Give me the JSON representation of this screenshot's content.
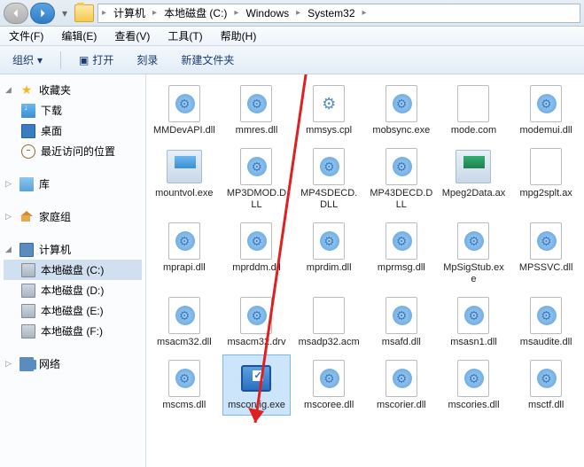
{
  "breadcrumb": {
    "items": [
      "计算机",
      "本地磁盘 (C:)",
      "Windows",
      "System32"
    ]
  },
  "menu": {
    "file": "文件(F)",
    "edit": "编辑(E)",
    "view": "查看(V)",
    "tools": "工具(T)",
    "help": "帮助(H)"
  },
  "toolbar": {
    "organize": "组织",
    "open": "打开",
    "burn": "刻录",
    "newfolder": "新建文件夹"
  },
  "sidebar": {
    "favorites": "收藏夹",
    "downloads": "下载",
    "desktop": "桌面",
    "recent": "最近访问的位置",
    "library": "库",
    "homegroup": "家庭组",
    "computer": "计算机",
    "drive_c": "本地磁盘 (C:)",
    "drive_d": "本地磁盘 (D:)",
    "drive_e": "本地磁盘 (E:)",
    "drive_f": "本地磁盘 (F:)",
    "network": "网络"
  },
  "files": [
    {
      "name": "MMDevAPI.dll",
      "type": "dll"
    },
    {
      "name": "mmres.dll",
      "type": "dll"
    },
    {
      "name": "mmsys.cpl",
      "type": "cpl"
    },
    {
      "name": "mobsync.exe",
      "type": "exe"
    },
    {
      "name": "mode.com",
      "type": "gen"
    },
    {
      "name": "modemui.dll",
      "type": "dll"
    },
    {
      "name": "mountvol.exe",
      "type": "mount"
    },
    {
      "name": "MP3DMOD.DLL",
      "type": "dll"
    },
    {
      "name": "MP4SDECD.DLL",
      "type": "dll"
    },
    {
      "name": "MP43DECD.DLL",
      "type": "dll"
    },
    {
      "name": "Mpeg2Data.ax",
      "type": "mpeg"
    },
    {
      "name": "mpg2splt.ax",
      "type": "gen"
    },
    {
      "name": "mprapi.dll",
      "type": "dll"
    },
    {
      "name": "mprddm.dll",
      "type": "dll"
    },
    {
      "name": "mprdim.dll",
      "type": "dll"
    },
    {
      "name": "mprmsg.dll",
      "type": "dll"
    },
    {
      "name": "MpSigStub.exe",
      "type": "exe"
    },
    {
      "name": "MPSSVC.dll",
      "type": "dll"
    },
    {
      "name": "msacm32.dll",
      "type": "dll"
    },
    {
      "name": "msacm32.drv",
      "type": "dll"
    },
    {
      "name": "msadp32.acm",
      "type": "gen"
    },
    {
      "name": "msafd.dll",
      "type": "dll"
    },
    {
      "name": "msasn1.dll",
      "type": "dll"
    },
    {
      "name": "msaudite.dll",
      "type": "dll"
    },
    {
      "name": "mscms.dll",
      "type": "dll"
    },
    {
      "name": "msconfig.exe",
      "type": "msconfig",
      "selected": true
    },
    {
      "name": "mscoree.dll",
      "type": "dll"
    },
    {
      "name": "mscorier.dll",
      "type": "dll"
    },
    {
      "name": "mscories.dll",
      "type": "dll"
    },
    {
      "name": "msctf.dll",
      "type": "dll"
    }
  ]
}
